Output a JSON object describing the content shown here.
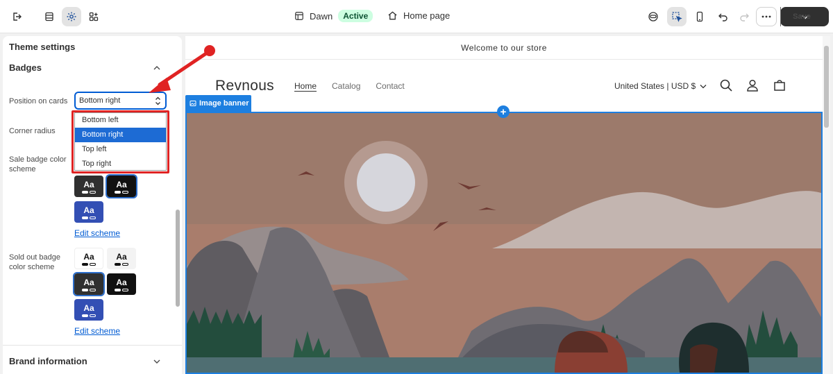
{
  "topbar": {
    "theme_name": "Dawn",
    "theme_status": "Active",
    "page_name": "Home page",
    "save_label": "Save"
  },
  "panel": {
    "title": "Theme settings",
    "section": "Badges",
    "position_label": "Position on cards",
    "position_value": "Bottom right",
    "position_options": [
      "Bottom left",
      "Bottom right",
      "Top left",
      "Top right"
    ],
    "corner_label": "Corner radius",
    "sale_label_1": "Sale badge color",
    "sale_label_2": "scheme",
    "sold_label_1": "Sold out badge",
    "sold_label_2": "color scheme",
    "swatch_text": "Aa",
    "edit_scheme": "Edit scheme",
    "brand_section": "Brand information"
  },
  "preview": {
    "announcement": "Welcome to our store",
    "store_name": "Revnous",
    "nav": [
      "Home",
      "Catalog",
      "Contact"
    ],
    "country": "United States | USD $",
    "section_tag": "Image banner"
  },
  "colors": {
    "accent": "#005bd3",
    "highlight": "#e02323",
    "selection": "#1d7fe0"
  }
}
